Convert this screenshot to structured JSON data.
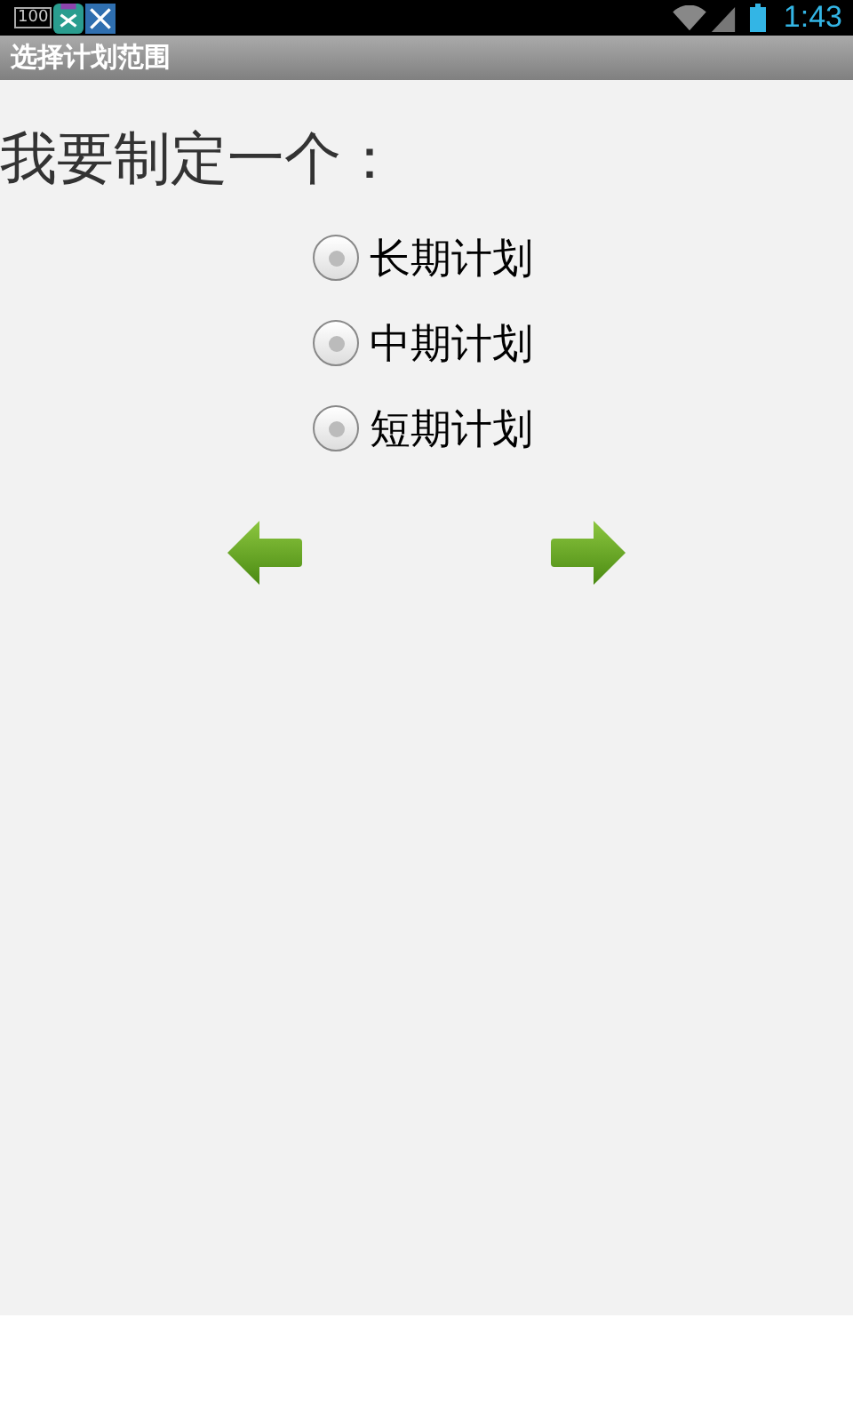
{
  "status_bar": {
    "notification_badge": "100",
    "time": "1:43"
  },
  "title_bar": {
    "title": "选择计划范围"
  },
  "heading": "我要制定一个：",
  "options": [
    {
      "label": "长期计划",
      "selected": false
    },
    {
      "label": "中期计划",
      "selected": false
    },
    {
      "label": "短期计划",
      "selected": false
    }
  ]
}
